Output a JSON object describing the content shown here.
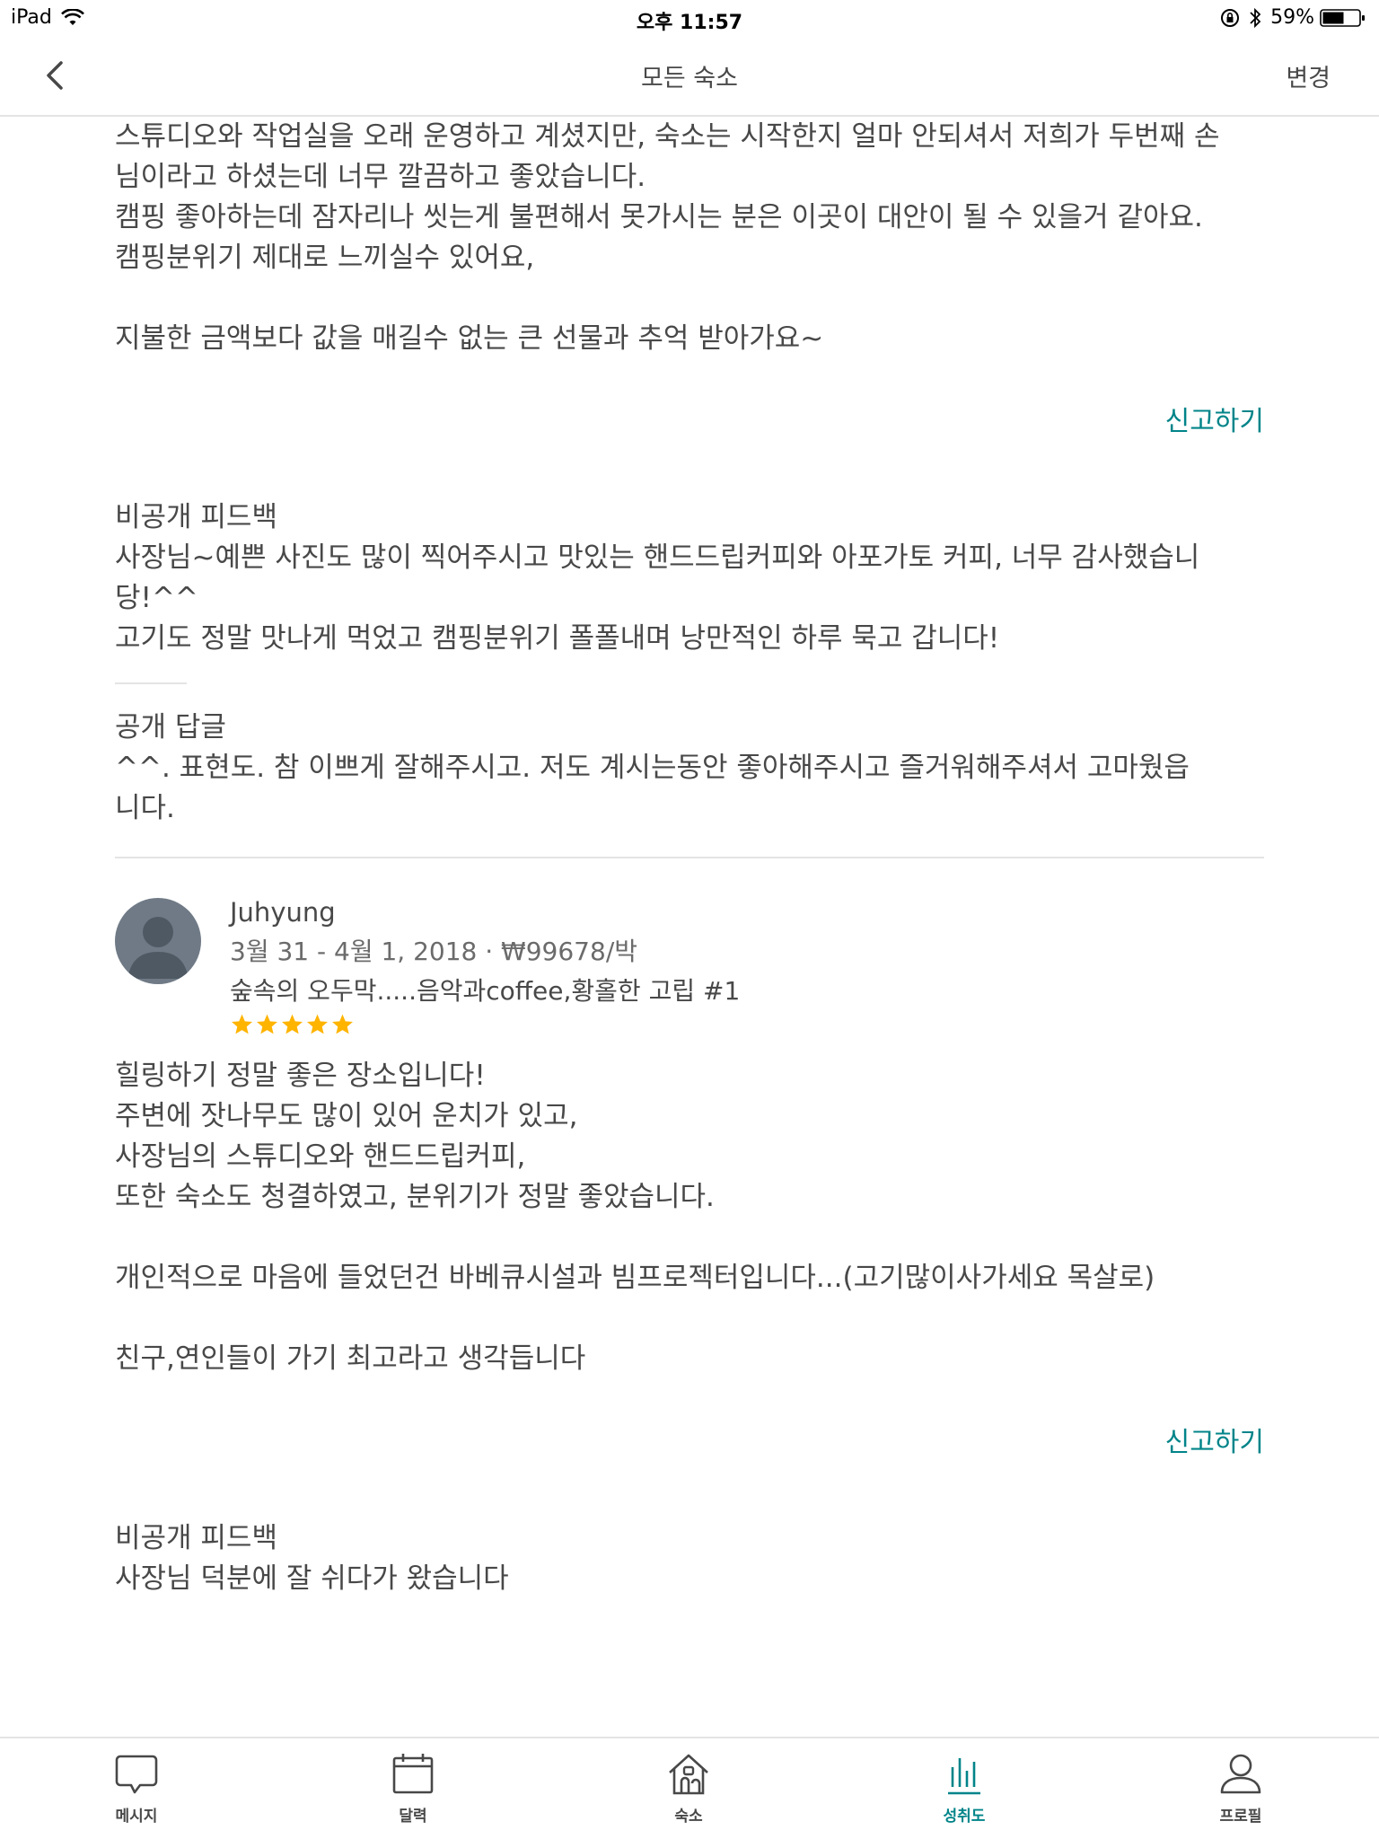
{
  "status_bar": {
    "device": "iPad",
    "time": "오후 11:57",
    "battery": "59%"
  },
  "nav": {
    "title": "모든 숙소",
    "right_action": "변경"
  },
  "review1": {
    "body_lines": [
      "스튜디오와 작업실을 오래 운영하고 계셨지만, 숙소는 시작한지 얼마 안되셔서 저희가 두번째 손",
      "님이라고 하셨는데 너무 깔끔하고 좋았습니다.",
      "캠핑 좋아하는데 잠자리나 씻는게 불편해서 못가시는 분은 이곳이 대안이 될 수 있을거 같아요.",
      "캠핑분위기 제대로 느끼실수 있어요,",
      "",
      "지불한 금액보다 값을 매길수 없는 큰 선물과 추억 받아가요~"
    ],
    "report_label": "신고하기",
    "private_feedback_heading": "비공개 피드백",
    "private_feedback_lines": [
      "사장님~예쁜 사진도 많이 찍어주시고 맛있는 핸드드립커피와 아포가토 커피, 너무 감사했습니",
      "당!^^",
      "고기도 정말 맛나게 먹었고 캠핑분위기 폴폴내며 낭만적인 하루 묵고 갑니다!"
    ],
    "public_reply_heading": "공개 답글",
    "public_reply_lines": [
      "^^. 표현도. 참 이쁘게 잘해주시고. 저도 계시는동안 좋아해주시고 즐거워해주셔서 고마웠읍",
      "니다."
    ]
  },
  "review2": {
    "reviewer_name": "Juhyung",
    "meta": "3월 31 - 4월 1, 2018 · ₩99678/박",
    "listing": "숲속의 오두막.....음악과coffee,황홀한 고립 #1",
    "rating": 5,
    "body_lines": [
      "힐링하기 정말 좋은 장소입니다!",
      "주변에 잣나무도 많이 있어 운치가 있고,",
      "사장님의 스튜디오와 핸드드립커피,",
      "또한 숙소도 청결하였고, 분위기가 정말 좋았습니다.",
      "",
      "개인적으로 마음에 들었던건 바베큐시설과 빔프로젝터입니다...(고기많이사가세요 목살로)",
      "",
      "친구,연인들이 가기 최고라고 생각듭니다"
    ],
    "report_label": "신고하기",
    "private_feedback_heading": "비공개 피드백",
    "private_feedback_lines": [
      "사장님 덕분에 잘 쉬다가 왔습니다"
    ]
  },
  "tabs": [
    {
      "label": "메시지",
      "icon": "message-icon"
    },
    {
      "label": "달력",
      "icon": "calendar-icon"
    },
    {
      "label": "숙소",
      "icon": "house-icon"
    },
    {
      "label": "성취도",
      "icon": "bar-chart-icon"
    },
    {
      "label": "프로필",
      "icon": "profile-icon"
    }
  ],
  "active_tab": "성취도",
  "colors": {
    "accent": "#008489",
    "text": "#484848",
    "star": "#FFB400",
    "divider": "#e4e4e4"
  }
}
